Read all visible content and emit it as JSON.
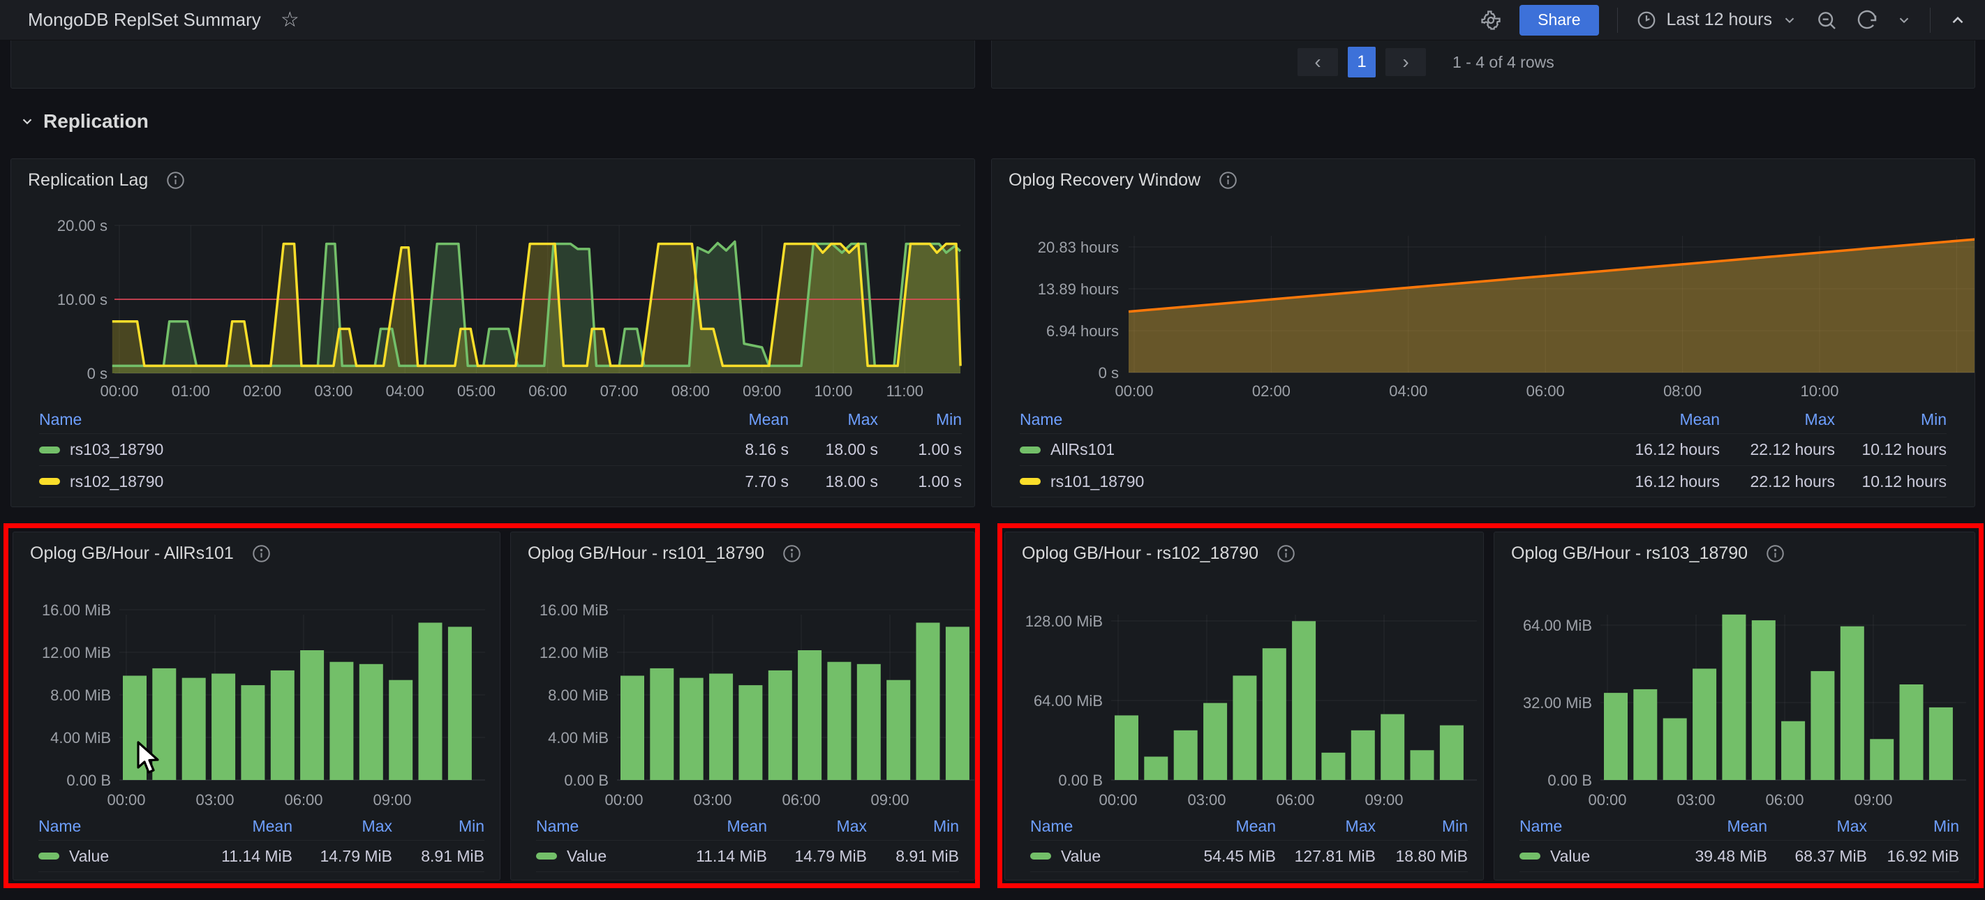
{
  "header": {
    "title": "MongoDB ReplSet Summary",
    "share_label": "Share",
    "time_range_label": "Last 12 hours"
  },
  "pagination": {
    "current_page": "1",
    "info": "1 - 4 of 4 rows"
  },
  "section": {
    "title": "Replication"
  },
  "colors": {
    "green": "#73BF69",
    "yellow": "#FADE2A",
    "orange": "#FF780A",
    "area_fill": "#EAB839",
    "threshold_red": "#F2495C",
    "accent_blue": "#3D71D9",
    "legend_header_blue": "#6E9FFF",
    "annotation_red": "#FF0000",
    "bar_green": "#73BF69"
  },
  "panels": {
    "replication_lag": {
      "title": "Replication Lag",
      "chart_data": {
        "type": "line",
        "unit": "seconds",
        "ylim": [
          0,
          20
        ],
        "yticks": [
          {
            "label": "20.00 s",
            "value": 20
          },
          {
            "label": "10.00 s",
            "value": 10
          },
          {
            "label": "0 s",
            "value": 0
          }
        ],
        "xticks": [
          "00:00",
          "01:00",
          "02:00",
          "03:00",
          "04:00",
          "05:00",
          "06:00",
          "07:00",
          "08:00",
          "09:00",
          "10:00",
          "11:00"
        ],
        "threshold": {
          "value": 10,
          "color": "#F2495C"
        },
        "series": [
          {
            "name": "rs103_18790",
            "color": "#73BF69",
            "points": [
              [
                -0.1,
                1
              ],
              [
                0.62,
                1
              ],
              [
                0.7,
                7
              ],
              [
                0.95,
                7
              ],
              [
                1.08,
                1
              ],
              [
                2.78,
                1
              ],
              [
                2.9,
                17.5
              ],
              [
                3.02,
                17.5
              ],
              [
                3.12,
                1
              ],
              [
                3.58,
                1
              ],
              [
                3.66,
                6
              ],
              [
                3.82,
                6
              ],
              [
                3.92,
                1
              ],
              [
                4.28,
                1
              ],
              [
                4.45,
                17.5
              ],
              [
                4.75,
                17.5
              ],
              [
                4.88,
                1
              ],
              [
                5.1,
                1
              ],
              [
                5.18,
                6
              ],
              [
                5.45,
                6
              ],
              [
                5.58,
                1
              ],
              [
                5.95,
                1
              ],
              [
                6.08,
                17.5
              ],
              [
                6.32,
                17.5
              ],
              [
                6.42,
                16.8
              ],
              [
                6.58,
                16.8
              ],
              [
                6.68,
                1
              ],
              [
                7.0,
                1
              ],
              [
                7.08,
                6
              ],
              [
                7.25,
                6
              ],
              [
                7.35,
                1
              ],
              [
                7.98,
                1
              ],
              [
                8.1,
                17
              ],
              [
                8.25,
                16.3
              ],
              [
                8.38,
                17.6
              ],
              [
                8.5,
                16.6
              ],
              [
                8.62,
                17.8
              ],
              [
                8.75,
                4
              ],
              [
                9.0,
                3.5
              ],
              [
                9.1,
                1
              ],
              [
                9.55,
                1
              ],
              [
                9.72,
                17.5
              ],
              [
                9.98,
                17.5
              ],
              [
                10.12,
                16.3
              ],
              [
                10.25,
                17.5
              ],
              [
                10.45,
                17.5
              ],
              [
                10.58,
                1
              ],
              [
                10.85,
                1
              ],
              [
                11.02,
                17.5
              ],
              [
                11.48,
                17.5
              ],
              [
                11.58,
                16.3
              ],
              [
                11.7,
                17.2
              ],
              [
                11.78,
                16.5
              ]
            ]
          },
          {
            "name": "rs102_18790",
            "color": "#FADE2A",
            "points": [
              [
                -0.1,
                7
              ],
              [
                0.25,
                7
              ],
              [
                0.35,
                1
              ],
              [
                1.5,
                1
              ],
              [
                1.58,
                7
              ],
              [
                1.75,
                7
              ],
              [
                1.85,
                1
              ],
              [
                2.12,
                1
              ],
              [
                2.3,
                17.5
              ],
              [
                2.45,
                17.5
              ],
              [
                2.55,
                1
              ],
              [
                3.0,
                1
              ],
              [
                3.08,
                6
              ],
              [
                3.22,
                6
              ],
              [
                3.32,
                1
              ],
              [
                3.7,
                1
              ],
              [
                3.95,
                17
              ],
              [
                4.05,
                17
              ],
              [
                4.18,
                1
              ],
              [
                4.7,
                1
              ],
              [
                4.78,
                6
              ],
              [
                4.92,
                6
              ],
              [
                5.02,
                1
              ],
              [
                5.55,
                1
              ],
              [
                5.75,
                17.5
              ],
              [
                6.1,
                17.5
              ],
              [
                6.22,
                1
              ],
              [
                6.55,
                1
              ],
              [
                6.62,
                6
              ],
              [
                6.78,
                6
              ],
              [
                6.88,
                1
              ],
              [
                7.32,
                1
              ],
              [
                7.55,
                17.5
              ],
              [
                8.02,
                17.5
              ],
              [
                8.15,
                6
              ],
              [
                8.32,
                6
              ],
              [
                8.45,
                1
              ],
              [
                9.1,
                1
              ],
              [
                9.32,
                17.5
              ],
              [
                9.75,
                17.5
              ],
              [
                9.85,
                16.3
              ],
              [
                9.97,
                17.5
              ],
              [
                10.1,
                17.5
              ],
              [
                10.22,
                16.3
              ],
              [
                10.35,
                17.5
              ],
              [
                10.48,
                1
              ],
              [
                10.9,
                1
              ],
              [
                11.08,
                17.5
              ],
              [
                11.35,
                17.5
              ],
              [
                11.45,
                16.3
              ],
              [
                11.58,
                17.5
              ],
              [
                11.72,
                17.5
              ],
              [
                11.78,
                1
              ]
            ]
          }
        ]
      },
      "legend": {
        "headers": [
          "Name",
          "Mean",
          "Max",
          "Min"
        ],
        "rows": [
          {
            "name": "rs103_18790",
            "mean": "8.16 s",
            "max": "18.00 s",
            "min": "1.00 s"
          },
          {
            "name": "rs102_18790",
            "mean": "7.70 s",
            "max": "18.00 s",
            "min": "1.00 s"
          }
        ]
      }
    },
    "oplog_recovery_window": {
      "title": "Oplog Recovery Window",
      "chart_data": {
        "type": "area",
        "unit": "hours",
        "yticks": [
          {
            "label": "20.83 hours",
            "value": 20.83
          },
          {
            "label": "13.89 hours",
            "value": 13.89
          },
          {
            "label": "6.94 hours",
            "value": 6.94
          },
          {
            "label": "0 s",
            "value": 0
          }
        ],
        "xticks": [
          "00:00",
          "02:00",
          "04:00",
          "06:00",
          "08:00",
          "10:00"
        ],
        "line_color": "#FF780A",
        "fill_color": "#EAB839",
        "fill_opacity": 0.38,
        "series": [
          {
            "name": "AllRs101",
            "color": "#73BF69",
            "points": [
              [
                0,
                10.12
              ],
              [
                12.3,
                22.12
              ]
            ]
          },
          {
            "name": "rs101_18790",
            "color": "#FADE2A",
            "points": [
              [
                0,
                10.12
              ],
              [
                12.3,
                22.12
              ]
            ]
          }
        ]
      },
      "legend": {
        "headers": [
          "Name",
          "Mean",
          "Max",
          "Min"
        ],
        "rows": [
          {
            "name": "AllRs101",
            "mean": "16.12 hours",
            "max": "22.12 hours",
            "min": "10.12 hours"
          },
          {
            "name": "rs101_18790",
            "mean": "16.12 hours",
            "max": "22.12 hours",
            "min": "10.12 hours"
          }
        ]
      }
    },
    "oplog_allrs101": {
      "title": "Oplog GB/Hour - AllRs101",
      "chart_data": {
        "type": "bar",
        "unit": "MiB",
        "bar_color": "#73BF69",
        "yticks": [
          {
            "label": "16.00 MiB",
            "value": 16
          },
          {
            "label": "12.00 MiB",
            "value": 12
          },
          {
            "label": "8.00 MiB",
            "value": 8
          },
          {
            "label": "4.00 MiB",
            "value": 4
          },
          {
            "label": "0.00 B",
            "value": 0
          }
        ],
        "xticks": [
          "00:00",
          "03:00",
          "06:00",
          "09:00"
        ],
        "values": [
          9.8,
          10.5,
          9.6,
          10.0,
          8.91,
          10.3,
          12.2,
          11.1,
          10.9,
          9.4,
          14.79,
          14.4
        ]
      },
      "legend": {
        "headers": [
          "Name",
          "Mean",
          "Max",
          "Min"
        ],
        "rows": [
          {
            "name": "Value",
            "mean": "11.14 MiB",
            "max": "14.79 MiB",
            "min": "8.91 MiB"
          }
        ]
      }
    },
    "oplog_rs101": {
      "title": "Oplog GB/Hour - rs101_18790",
      "chart_data": {
        "type": "bar",
        "unit": "MiB",
        "bar_color": "#73BF69",
        "yticks": [
          {
            "label": "16.00 MiB",
            "value": 16
          },
          {
            "label": "12.00 MiB",
            "value": 12
          },
          {
            "label": "8.00 MiB",
            "value": 8
          },
          {
            "label": "4.00 MiB",
            "value": 4
          },
          {
            "label": "0.00 B",
            "value": 0
          }
        ],
        "xticks": [
          "00:00",
          "03:00",
          "06:00",
          "09:00"
        ],
        "values": [
          9.8,
          10.5,
          9.6,
          10.0,
          8.91,
          10.3,
          12.2,
          11.1,
          10.9,
          9.4,
          14.79,
          14.4
        ]
      },
      "legend": {
        "headers": [
          "Name",
          "Mean",
          "Max",
          "Min"
        ],
        "rows": [
          {
            "name": "Value",
            "mean": "11.14 MiB",
            "max": "14.79 MiB",
            "min": "8.91 MiB"
          }
        ]
      }
    },
    "oplog_rs102": {
      "title": "Oplog GB/Hour - rs102_18790",
      "chart_data": {
        "type": "bar",
        "unit": "MiB",
        "bar_color": "#73BF69",
        "yticks": [
          {
            "label": "128.00 MiB",
            "value": 128
          },
          {
            "label": "64.00 MiB",
            "value": 64
          },
          {
            "label": "0.00 B",
            "value": 0
          }
        ],
        "xticks": [
          "00:00",
          "03:00",
          "06:00",
          "09:00"
        ],
        "values": [
          52,
          18.8,
          40,
          62,
          84,
          106,
          127.81,
          22,
          40,
          53,
          24,
          44
        ]
      },
      "legend": {
        "headers": [
          "Name",
          "Mean",
          "Max",
          "Min"
        ],
        "rows": [
          {
            "name": "Value",
            "mean": "54.45 MiB",
            "max": "127.81 MiB",
            "min": "18.80 MiB"
          }
        ]
      }
    },
    "oplog_rs103": {
      "title": "Oplog GB/Hour - rs103_18790",
      "chart_data": {
        "type": "bar",
        "unit": "MiB",
        "bar_color": "#73BF69",
        "yticks": [
          {
            "label": "64.00 MiB",
            "value": 64
          },
          {
            "label": "32.00 MiB",
            "value": 32
          },
          {
            "label": "0.00 B",
            "value": 0
          }
        ],
        "xticks": [
          "00:00",
          "03:00",
          "06:00",
          "09:00"
        ],
        "values": [
          36,
          37.5,
          25.5,
          46,
          68.37,
          66,
          24.3,
          45,
          63.5,
          16.92,
          39.5,
          30
        ]
      },
      "legend": {
        "headers": [
          "Name",
          "Mean",
          "Max",
          "Min"
        ],
        "rows": [
          {
            "name": "Value",
            "mean": "39.48 MiB",
            "max": "68.37 MiB",
            "min": "16.92 MiB"
          }
        ]
      }
    }
  }
}
